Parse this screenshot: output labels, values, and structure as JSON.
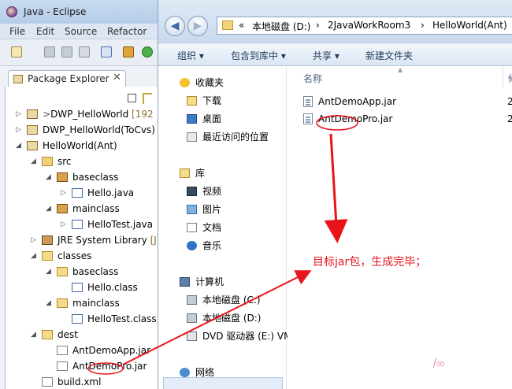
{
  "eclipse": {
    "title": "Java - Eclipse",
    "menu": [
      "File",
      "Edit",
      "Source",
      "Refactor"
    ],
    "view_tab": "Package Explorer",
    "view_tab_close": "✕",
    "tree": [
      {
        "label": "DWP_HelloWorld",
        "prefix": ">",
        "trail": "[192",
        "depth": 0,
        "twisty": "▷",
        "icon": "project-icon"
      },
      {
        "label": "DWP_HelloWorld(ToCvs)",
        "prefix": "",
        "trail": "",
        "depth": 0,
        "twisty": "▷",
        "icon": "project-icon"
      },
      {
        "label": "HelloWorld(Ant)",
        "prefix": "",
        "trail": "",
        "depth": 0,
        "twisty": "◢",
        "icon": "project-icon"
      },
      {
        "label": "src",
        "prefix": "",
        "trail": "",
        "depth": 1,
        "twisty": "◢",
        "icon": "source-folder-icon"
      },
      {
        "label": "baseclass",
        "prefix": "",
        "trail": "",
        "depth": 2,
        "twisty": "◢",
        "icon": "package-icon"
      },
      {
        "label": "Hello.java",
        "prefix": "",
        "trail": "",
        "depth": 3,
        "twisty": "▷",
        "icon": "java-file-icon"
      },
      {
        "label": "mainclass",
        "prefix": "",
        "trail": "",
        "depth": 2,
        "twisty": "◢",
        "icon": "package-icon"
      },
      {
        "label": "HelloTest.java",
        "prefix": "",
        "trail": "",
        "depth": 3,
        "twisty": "▷",
        "icon": "java-file-icon"
      },
      {
        "label": "JRE System Library",
        "prefix": "",
        "trail": "[J",
        "depth": 1,
        "twisty": "▷",
        "icon": "library-icon"
      },
      {
        "label": "classes",
        "prefix": "",
        "trail": "",
        "depth": 1,
        "twisty": "◢",
        "icon": "folder-icon"
      },
      {
        "label": "baseclass",
        "prefix": "",
        "trail": "",
        "depth": 2,
        "twisty": "◢",
        "icon": "folder-icon"
      },
      {
        "label": "Hello.class",
        "prefix": "",
        "trail": "",
        "depth": 3,
        "twisty": "",
        "icon": "class-file-icon"
      },
      {
        "label": "mainclass",
        "prefix": "",
        "trail": "",
        "depth": 2,
        "twisty": "◢",
        "icon": "folder-icon"
      },
      {
        "label": "HelloTest.class",
        "prefix": "",
        "trail": "",
        "depth": 3,
        "twisty": "",
        "icon": "class-file-icon"
      },
      {
        "label": "dest",
        "prefix": "",
        "trail": "",
        "depth": 1,
        "twisty": "◢",
        "icon": "folder-icon"
      },
      {
        "label": "AntDemoApp.jar",
        "prefix": "",
        "trail": "",
        "depth": 2,
        "twisty": "",
        "icon": "jar-file-icon"
      },
      {
        "label": "AntDemoPro.jar",
        "prefix": "",
        "trail": "",
        "depth": 2,
        "twisty": "",
        "icon": "jar-file-icon"
      },
      {
        "label": "build.xml",
        "prefix": "",
        "trail": "",
        "depth": 1,
        "twisty": "",
        "icon": "xml-file-icon"
      }
    ]
  },
  "explorer": {
    "breadcrumb": [
      "«",
      "本地磁盘 (D:)",
      "›",
      "2JavaWorkRoom3",
      "›",
      "HelloWorld(Ant)"
    ],
    "commands": [
      "组织 ▾",
      "包含到库中 ▾",
      "共享 ▾",
      "新建文件夹"
    ],
    "nav": [
      {
        "label": "收藏夹",
        "icon": "star-icon",
        "indent": 0
      },
      {
        "label": "下载",
        "icon": "downloads-folder-icon",
        "indent": 1
      },
      {
        "label": "桌面",
        "icon": "desktop-icon",
        "indent": 1
      },
      {
        "label": "最近访问的位置",
        "icon": "recent-places-icon",
        "indent": 1
      },
      {
        "label": "库",
        "icon": "library-icon",
        "indent": 0
      },
      {
        "label": "视频",
        "icon": "video-library-icon",
        "indent": 1
      },
      {
        "label": "图片",
        "icon": "pictures-library-icon",
        "indent": 1
      },
      {
        "label": "文档",
        "icon": "documents-library-icon",
        "indent": 1
      },
      {
        "label": "音乐",
        "icon": "music-library-icon",
        "indent": 1
      },
      {
        "label": "计算机",
        "icon": "computer-icon",
        "indent": 0
      },
      {
        "label": "本地磁盘 (C:)",
        "icon": "drive-c-icon",
        "indent": 1
      },
      {
        "label": "本地磁盘 (D:)",
        "icon": "drive-d-icon",
        "indent": 1
      },
      {
        "label": "DVD 驱动器 (E:) VM",
        "icon": "dvd-drive-icon",
        "indent": 1
      },
      {
        "label": "网络",
        "icon": "network-icon",
        "indent": 0
      }
    ],
    "columns": {
      "name": "名称",
      "right_cut": "修"
    },
    "files": [
      {
        "name": "AntDemoApp.jar",
        "cut": "2"
      },
      {
        "name": "AntDemoPro.jar",
        "cut": "2"
      }
    ]
  },
  "annotation": {
    "text": "目标jar包，生成完毕；",
    "color": "#e8141a"
  },
  "colors": {
    "eclipse_bg": "#eef1f6",
    "explorer_header": "#c9daee",
    "selection": "#e3ecf8"
  }
}
